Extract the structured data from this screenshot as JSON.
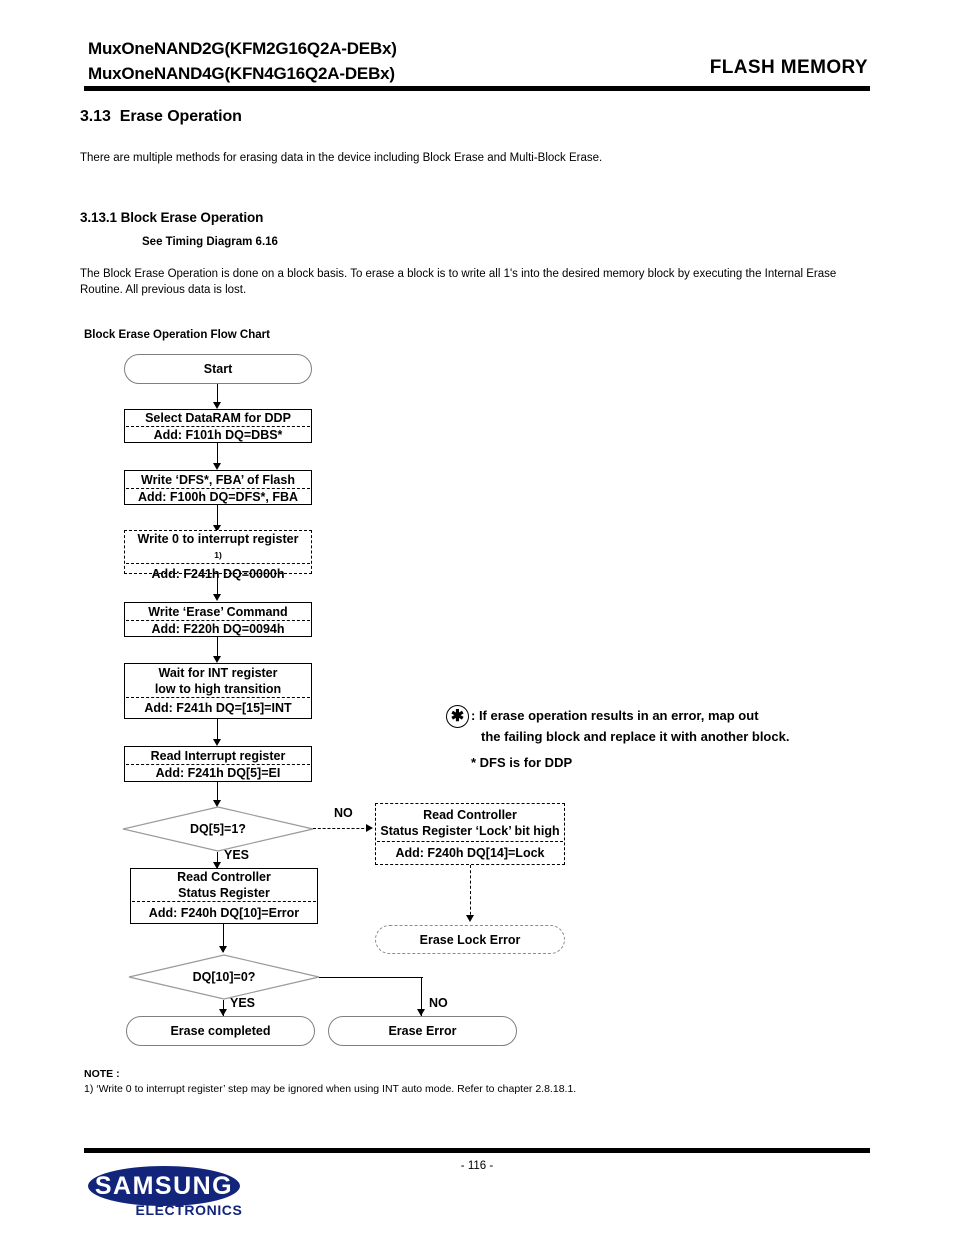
{
  "header": {
    "title_line1": "MuxOneNAND2G(KFM2G16Q2A-DEBx)",
    "title_line2": "MuxOneNAND4G(KFN4G16Q2A-DEBx)",
    "right_label": "FLASH MEMORY"
  },
  "section": {
    "number": "3.13",
    "title": "Erase Operation",
    "intro": "There are multiple methods for erasing data in the device including Block Erase and Multi-Block Erase.",
    "subsection_title": "3.13.1 Block Erase Operation",
    "see_timing": "See Timing Diagram 6.16",
    "body": "The Block Erase Operation is done on a block basis. To erase a block is to write all 1's into the desired memory block by executing the Internal Erase Routine. All previous data is lost.",
    "flow_caption": "Block Erase Operation Flow Chart"
  },
  "flowchart": {
    "start": "Start",
    "step1": {
      "title": "Select DataRAM for DDP",
      "address": "Add: F101h DQ=DBS*"
    },
    "step2": {
      "title": "Write ‘DFS*, FBA’ of Flash",
      "address": "Add: F100h DQ=DFS*, FBA"
    },
    "step3": {
      "title": "Write 0 to interrupt register",
      "title_sup": "1)",
      "address": "Add: F241h DQ=0000h"
    },
    "step4": {
      "title": "Write ‘Erase’ Command",
      "address": "Add: F220h DQ=0094h"
    },
    "step5": {
      "title_line1": "Wait for INT register",
      "title_line2": "low to high transition",
      "address": "Add: F241h DQ=[15]=INT"
    },
    "step6": {
      "title": "Read Interrupt register",
      "address": "Add: F241h DQ[5]=EI"
    },
    "decision1": "DQ[5]=1?",
    "decision1_yes": "YES",
    "decision1_no": "NO",
    "step7": {
      "title_line1": "Read Controller",
      "title_line2": "Status Register",
      "address": "Add: F240h DQ[10]=Error"
    },
    "step_lock": {
      "title_line1": "Read Controller",
      "title_line2": "Status Register ‘Lock’ bit high",
      "address": "Add: F240h DQ[14]=Lock"
    },
    "erase_lock_error": "Erase Lock Error",
    "decision2": "DQ[10]=0?",
    "decision2_yes": "YES",
    "decision2_no": "NO",
    "erase_completed": "Erase completed",
    "erase_error": "Erase Error"
  },
  "legend": {
    "star_glyph": "✱",
    "line1": ": If erase operation results in an error, map out",
    "line2": "the failing block and replace it with another block.",
    "dfs_note": "* DFS is for DDP"
  },
  "note": {
    "heading": "NOTE :",
    "item1": "1) ‘Write 0 to interrupt register’ step may be ignored when using INT auto mode. Refer to chapter 2.8.18.1."
  },
  "footer": {
    "page_number": "- 116 -",
    "brand": "SAMSUNG",
    "brand_sub": "ELECTRONICS",
    "brand_color": "#12257b"
  }
}
